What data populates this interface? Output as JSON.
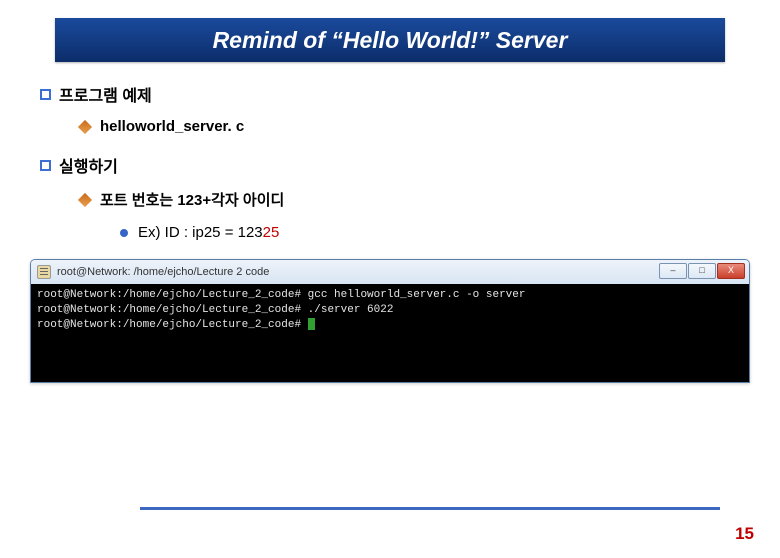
{
  "title": "Remind of “Hello World!” Server",
  "section1": {
    "heading": "프로그램 예제",
    "item": "helloworld_server. c"
  },
  "section2": {
    "heading": "실행하기",
    "item": "포트 번호는 123+각자 아이디",
    "example_prefix": "Ex) ID : ip25 = 123",
    "example_hi": "25"
  },
  "terminal": {
    "win_title": "root@Network: /home/ejcho/Lecture 2 code",
    "line1": "root@Network:/home/ejcho/Lecture_2_code# gcc helloworld_server.c -o server",
    "line2": "root@Network:/home/ejcho/Lecture_2_code# ./server 6022",
    "line3_prompt": "root@Network:/home/ejcho/Lecture_2_code# ",
    "min_label": "–",
    "max_label": "□",
    "close_label": "X"
  },
  "page_number": "15"
}
